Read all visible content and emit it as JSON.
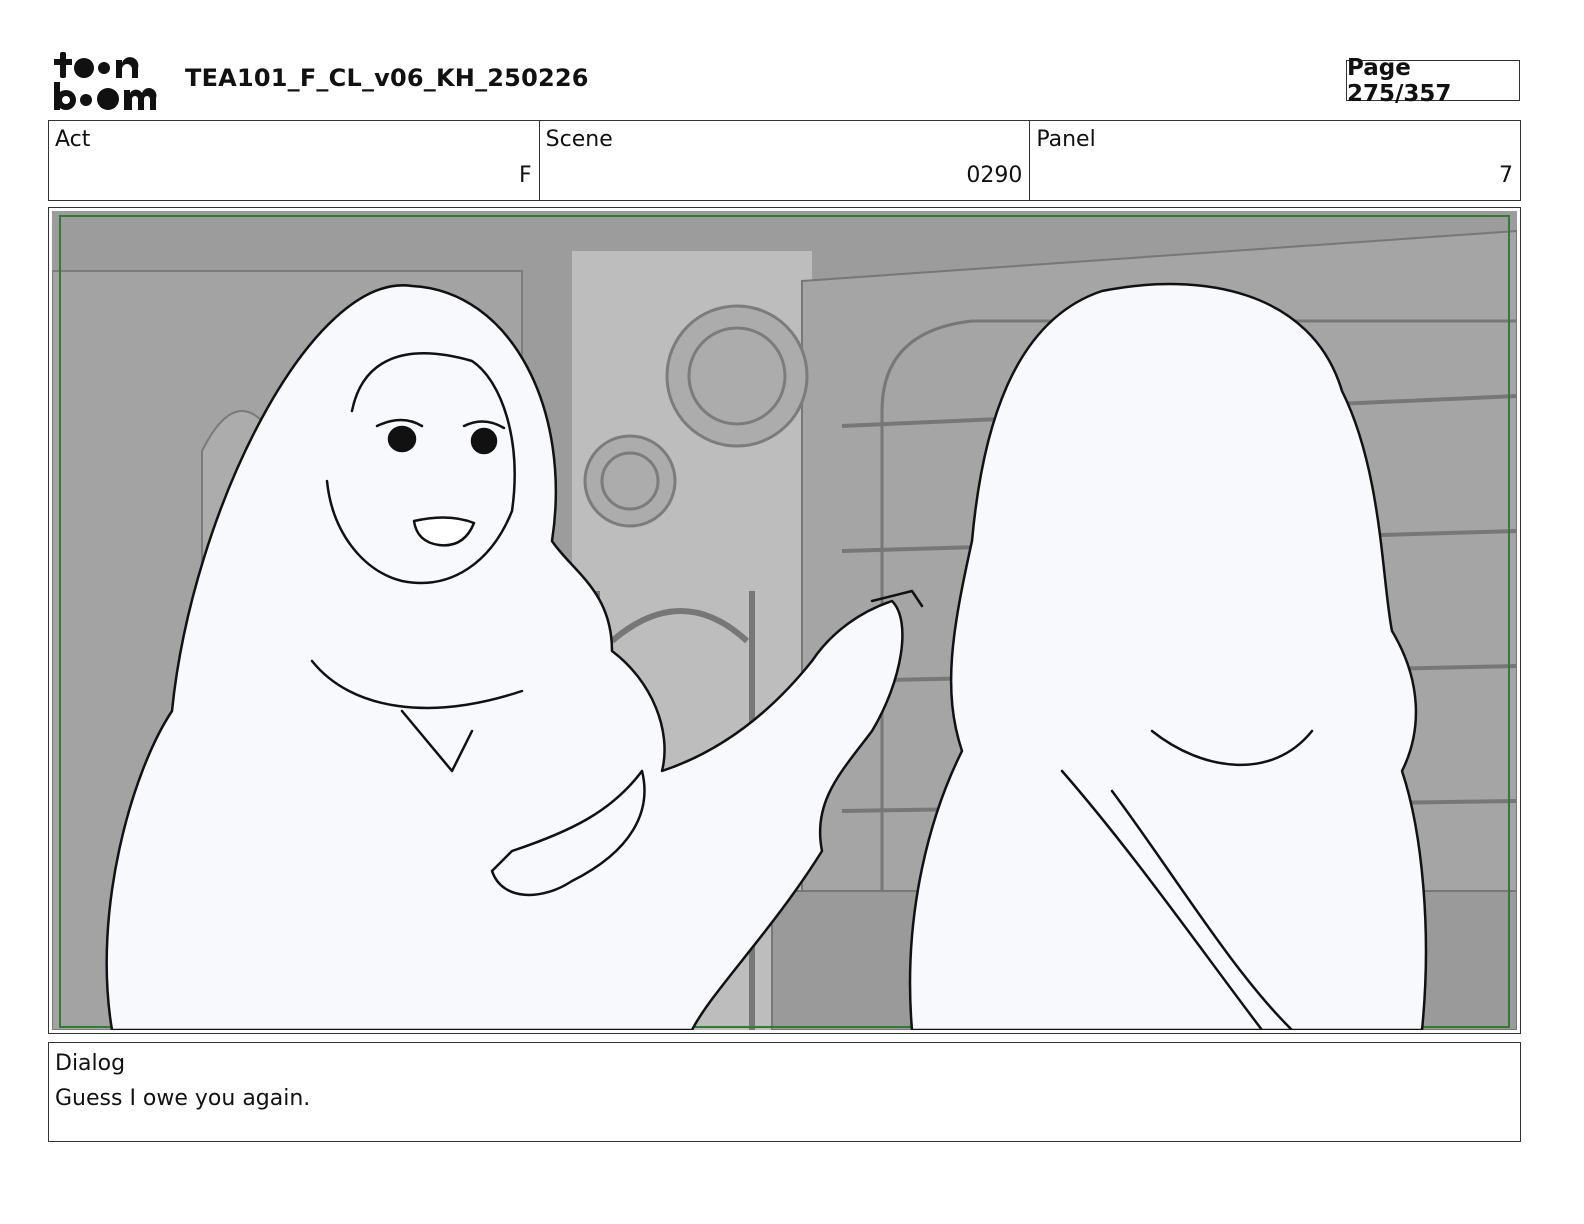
{
  "header": {
    "logo_text": "toon boom",
    "title": "TEA101_F_CL_v06_KH_250226",
    "page": "Page 275/357"
  },
  "info": {
    "act_label": "Act",
    "act_value": "F",
    "scene_label": "Scene",
    "scene_value": "0290",
    "panel_label": "Panel",
    "panel_value": "7"
  },
  "dialog": {
    "label": "Dialog",
    "text": "Guess I owe you again."
  },
  "colors": {
    "safe_frame": "#2e7d32",
    "background_gray": "#9e9e9e",
    "figure_fill": "#f8f9fc",
    "line": "#111111"
  }
}
